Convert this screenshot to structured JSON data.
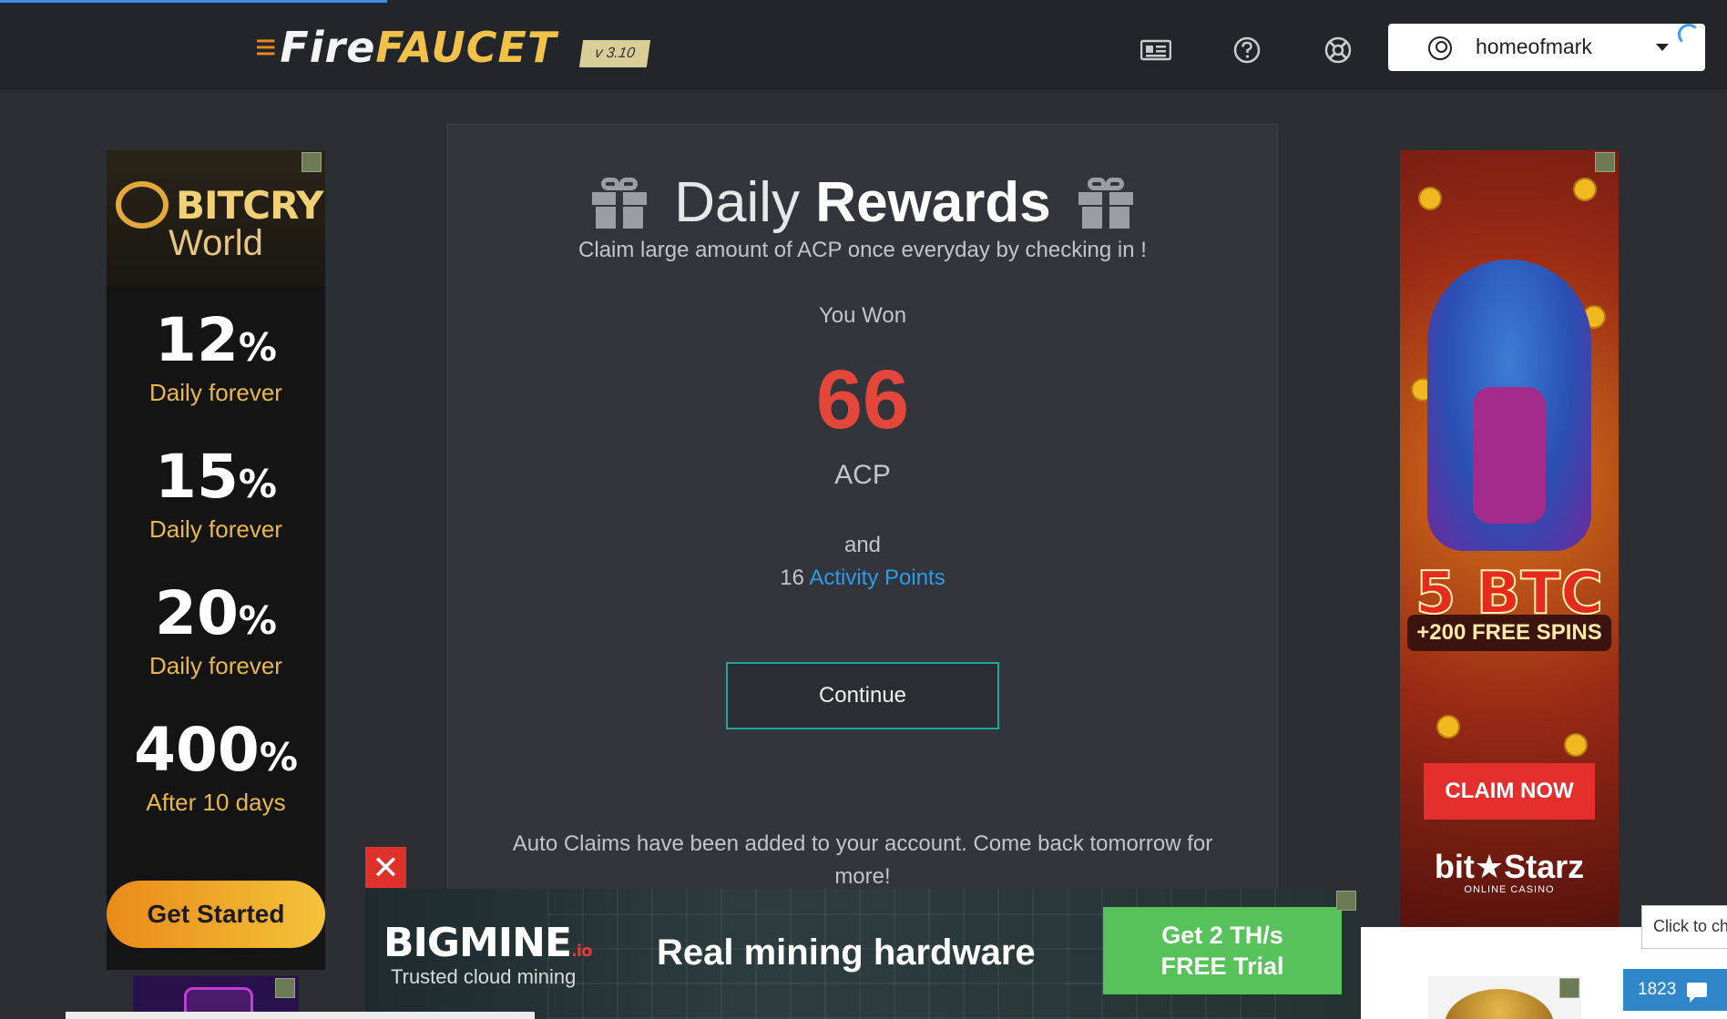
{
  "header": {
    "logo_main": "Fire",
    "logo_accent": "FAUCET",
    "version": "v 3.10",
    "nav_icons": [
      "news-icon",
      "help-icon",
      "support-icon"
    ],
    "user": {
      "name": "homeofmark",
      "icon": "user-circle-icon",
      "dropdown_icon": "caret-down-icon"
    }
  },
  "reward": {
    "title_light": "Daily",
    "title_bold": "Rewards",
    "subtitle": "Claim large amount of ACP once everyday by checking in !",
    "you_won": "You Won",
    "amount": "66",
    "unit": "ACP",
    "and": "and",
    "points_count": "16",
    "points_label": "Activity Points",
    "continue": "Continue",
    "auto_note": "Auto Claims have been added to your account. Come back tomorrow for more!"
  },
  "ads": {
    "left": {
      "brand_line1": "BITCRYP.",
      "brand_line2": "World",
      "rates": [
        {
          "pct": "12",
          "desc": "Daily forever"
        },
        {
          "pct": "15",
          "desc": "Daily forever"
        },
        {
          "pct": "20",
          "desc": "Daily forever"
        },
        {
          "pct": "400",
          "desc": "After 10 days"
        }
      ],
      "cta": "Get Started"
    },
    "right": {
      "headline": "5 BTC",
      "sub": "+200 FREE SPINS",
      "cta": "CLAIM NOW",
      "brand": "bit★Starz",
      "brand_sub": "ONLINE CASINO"
    },
    "bottom": {
      "logo": "BIGMINE",
      "logo_suffix": ".io",
      "tagline": "Trusted cloud mining",
      "headline": "Real mining hardware",
      "offer_line1": "Get 2 TH/s",
      "offer_line2": "FREE Trial",
      "close": "✕"
    }
  },
  "chat": {
    "prompt": "Click to ch",
    "count": "1823"
  },
  "colors": {
    "accent_red": "#e4473a",
    "link_blue": "#2b9bea",
    "button_border": "#1aa69a"
  }
}
